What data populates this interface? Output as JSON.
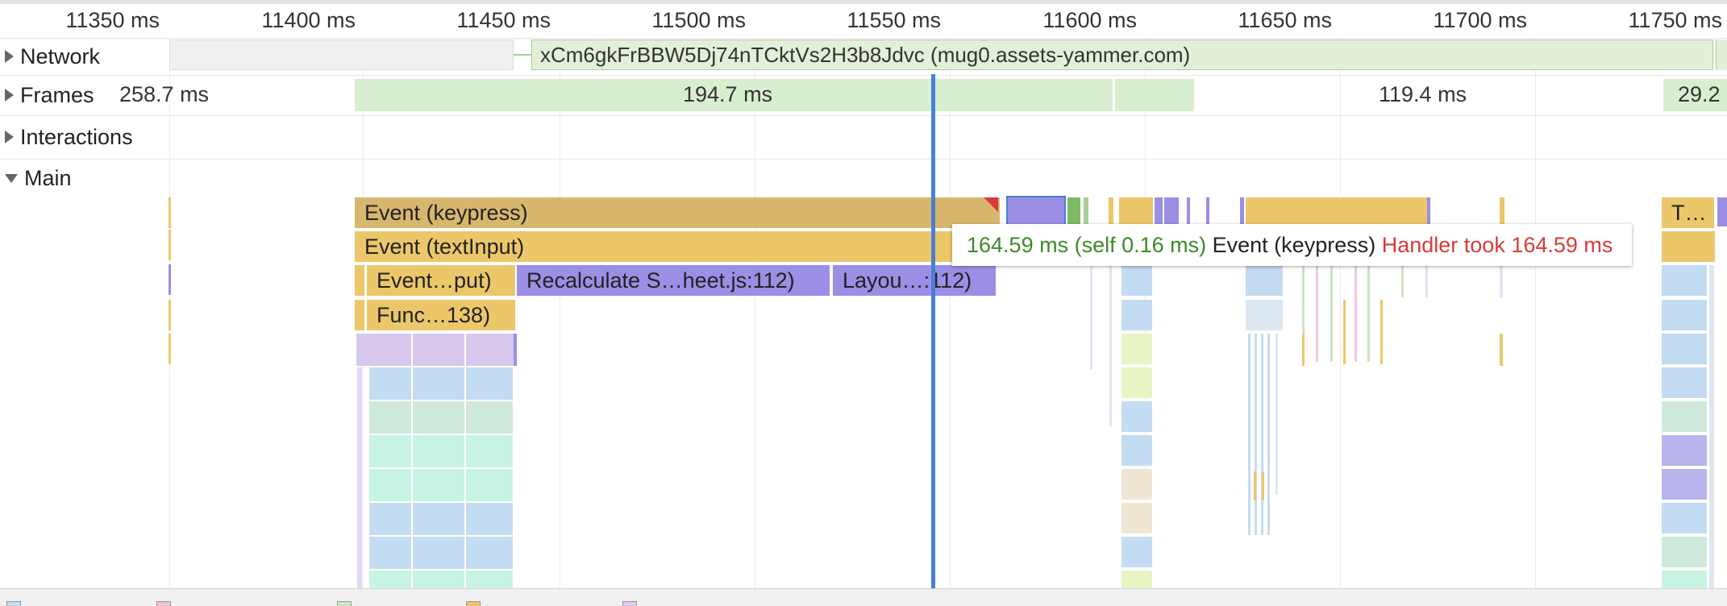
{
  "ruler": {
    "ticks": [
      "11350 ms",
      "11400 ms",
      "11450 ms",
      "11500 ms",
      "11550 ms",
      "11600 ms",
      "11650 ms",
      "11700 ms",
      "11750 ms"
    ]
  },
  "tracks": {
    "network": {
      "label": "Network",
      "request": "xCm6gkFrBBW5Dj74nTCktVs2H3b8Jdvc (mug0.assets-yammer.com)"
    },
    "frames": {
      "label": "Frames",
      "durations": [
        "258.7 ms",
        "194.7 ms",
        "119.4 ms",
        "29.2"
      ]
    },
    "interactions": {
      "label": "Interactions"
    },
    "main": {
      "label": "Main",
      "events": {
        "keypress": "Event (keypress)",
        "textinput": "Event (textInput)",
        "event_put": "Event…put)",
        "recalc": "Recalculate S…heet.js:112)",
        "layout": "Layou…:112)",
        "func": "Func…138)",
        "t_trunc": "T…"
      }
    }
  },
  "tooltip": {
    "duration": "164.59 ms (self 0.16 ms)",
    "event": "Event (keypress)",
    "warning": "Handler took 164.59 ms"
  },
  "colors": {
    "scripting": "#ecc76a",
    "rendering": "#9b8ee5",
    "painting": "#a9cf92",
    "cursor": "#4a7fd4",
    "warning": "#d83b3b"
  }
}
